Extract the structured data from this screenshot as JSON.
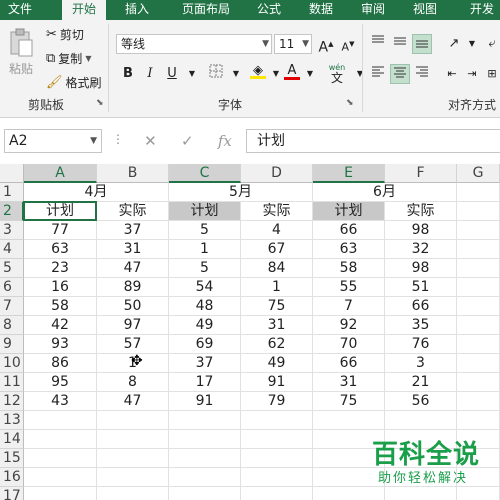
{
  "tabs": [
    "文件",
    "开始",
    "插入",
    "页面布局",
    "公式",
    "数据",
    "审阅",
    "视图",
    "开发"
  ],
  "active_tab": "开始",
  "clipboard": {
    "paste": "粘贴",
    "cut": "剪切",
    "copy": "复制",
    "format_painter": "格式刷",
    "group_label": "剪贴板"
  },
  "font": {
    "family": "等线",
    "size": "11",
    "grow": "A",
    "shrink": "A",
    "bold": "B",
    "italic": "I",
    "underline": "U",
    "wen": "wén",
    "wen_char": "文",
    "group_label": "字体"
  },
  "alignment": {
    "group_label": "对齐方式"
  },
  "name_box": "A2",
  "formula_value": "计划",
  "columns": [
    "A",
    "B",
    "C",
    "D",
    "E",
    "F",
    "G"
  ],
  "rows": [
    "1",
    "2",
    "3",
    "4",
    "5",
    "6",
    "7",
    "8",
    "9",
    "10",
    "11",
    "12",
    "13",
    "14",
    "15",
    "16",
    "17"
  ],
  "months": [
    "4月",
    "5月",
    "6月"
  ],
  "header_row": [
    "计划",
    "实际",
    "计划",
    "实际",
    "计划",
    "实际"
  ],
  "table": [
    [
      77,
      37,
      5,
      4,
      66,
      98
    ],
    [
      63,
      31,
      1,
      67,
      63,
      32
    ],
    [
      23,
      47,
      5,
      84,
      58,
      98
    ],
    [
      16,
      89,
      54,
      1,
      55,
      51
    ],
    [
      58,
      50,
      48,
      75,
      7,
      66
    ],
    [
      42,
      97,
      49,
      31,
      92,
      35
    ],
    [
      93,
      57,
      69,
      62,
      70,
      76
    ],
    [
      86,
      1,
      37,
      49,
      66,
      3
    ],
    [
      95,
      8,
      17,
      91,
      31,
      21
    ],
    [
      43,
      47,
      91,
      79,
      75,
      56
    ]
  ],
  "watermark": {
    "title": "百科全说",
    "subtitle": "助你轻松解决"
  }
}
